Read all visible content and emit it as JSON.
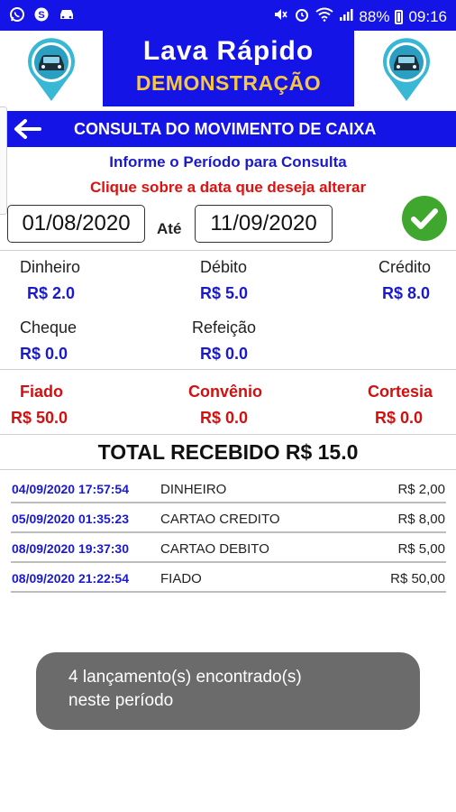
{
  "status_bar": {
    "battery": "88%",
    "time": "09:16"
  },
  "banner": {
    "title": "Lava Rápido",
    "subtitle": "DEMONSTRAÇÃO"
  },
  "header": {
    "title": "CONSULTA DO MOVIMENTO DE CAIXA"
  },
  "instructions": {
    "line1": "Informe o Período para Consulta",
    "line2": "Clique sobre a data que deseja alterar"
  },
  "period": {
    "from": "01/08/2020",
    "to_label": "Até",
    "to": "11/09/2020"
  },
  "summary": {
    "dinheiro": {
      "label": "Dinheiro",
      "value": "R$ 2.0"
    },
    "debito": {
      "label": "Débito",
      "value": "R$ 5.0"
    },
    "credito": {
      "label": "Crédito",
      "value": "R$ 8.0"
    },
    "cheque": {
      "label": "Cheque",
      "value": "R$ 0.0"
    },
    "refeicao": {
      "label": "Refeição",
      "value": "R$ 0.0"
    },
    "fiado": {
      "label": "Fiado",
      "value": "R$ 50.0"
    },
    "convenio": {
      "label": "Convênio",
      "value": "R$ 0.0"
    },
    "cortesia": {
      "label": "Cortesia",
      "value": "R$ 0.0"
    }
  },
  "total": "TOTAL RECEBIDO R$ 15.0",
  "transactions": [
    {
      "datetime": "04/09/2020 17:57:54",
      "description": "DINHEIRO",
      "amount": "R$ 2,00"
    },
    {
      "datetime": "05/09/2020 01:35:23",
      "description": "CARTAO CREDITO",
      "amount": "R$ 8,00"
    },
    {
      "datetime": "08/09/2020 19:37:30",
      "description": "CARTAO DEBITO",
      "amount": "R$ 5,00"
    },
    {
      "datetime": "08/09/2020 21:22:54",
      "description": "FIADO",
      "amount": "R$ 50,00"
    }
  ],
  "toast": {
    "line1": "4 lançamento(s) encontrado(s)",
    "line2": "neste período"
  },
  "colors": {
    "primary": "#1414e6",
    "accent_yellow": "#f7c744",
    "value_blue": "#1a1acc",
    "alert_red": "#d21010",
    "confirm_green": "#3fa62e",
    "toast_bg": "#6b6b6b"
  }
}
